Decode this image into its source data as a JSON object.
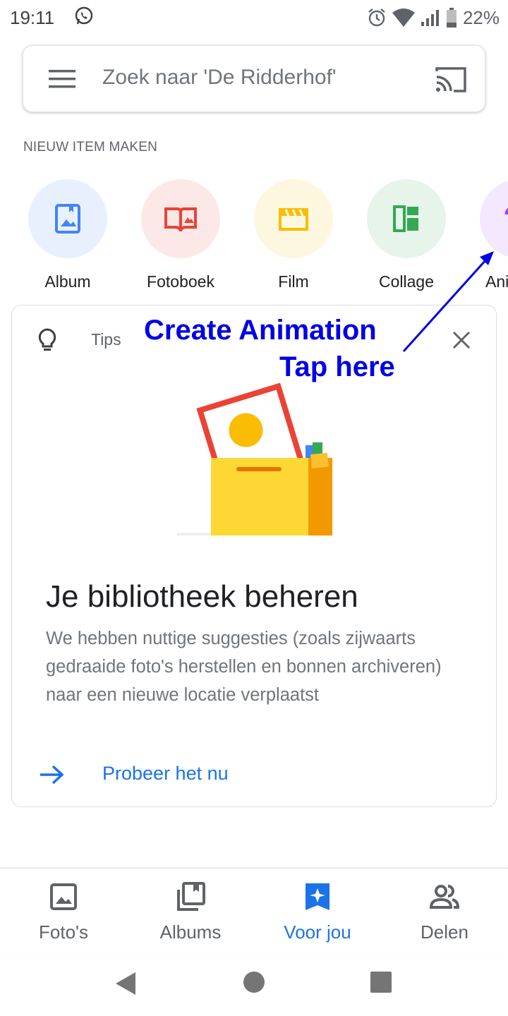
{
  "status_bar": {
    "time": "19:11",
    "battery": "22%"
  },
  "search": {
    "placeholder": "Zoek naar 'De Ridderhof'"
  },
  "create": {
    "section_title": "NIEUW ITEM MAKEN",
    "items": [
      {
        "label": "Album",
        "icon": "album-icon",
        "bg": "#e8f0fe",
        "color": "#4285f4"
      },
      {
        "label": "Fotoboek",
        "icon": "photobook-icon",
        "bg": "#fce8e6",
        "color": "#ea4335"
      },
      {
        "label": "Film",
        "icon": "film-icon",
        "bg": "#fef7e0",
        "color": "#fbbc04"
      },
      {
        "label": "Collage",
        "icon": "collage-icon",
        "bg": "#e6f4ea",
        "color": "#34a853"
      },
      {
        "label": "Ani",
        "icon": "animation-icon",
        "bg": "#f3e8fd",
        "color": "#a142f4"
      }
    ]
  },
  "card": {
    "tips_label": "Tips",
    "title": "Je bibliotheek beheren",
    "body": "We hebben nuttige suggesties (zoals zijwaarts gedraaide foto's herstellen en bonnen archiveren) naar een nieuwe locatie verplaatst",
    "action": "Probeer het nu"
  },
  "annotation": {
    "line1": "Create Animation",
    "line2": "Tap here",
    "color": "#0000e6"
  },
  "bottom_nav": {
    "items": [
      {
        "label": "Foto's",
        "icon": "photos-icon"
      },
      {
        "label": "Albums",
        "icon": "albums-icon"
      },
      {
        "label": "Voor jou",
        "icon": "for-you-icon",
        "active": true
      },
      {
        "label": "Delen",
        "icon": "sharing-icon"
      }
    ]
  },
  "colors": {
    "accent": "#1a73e8"
  }
}
